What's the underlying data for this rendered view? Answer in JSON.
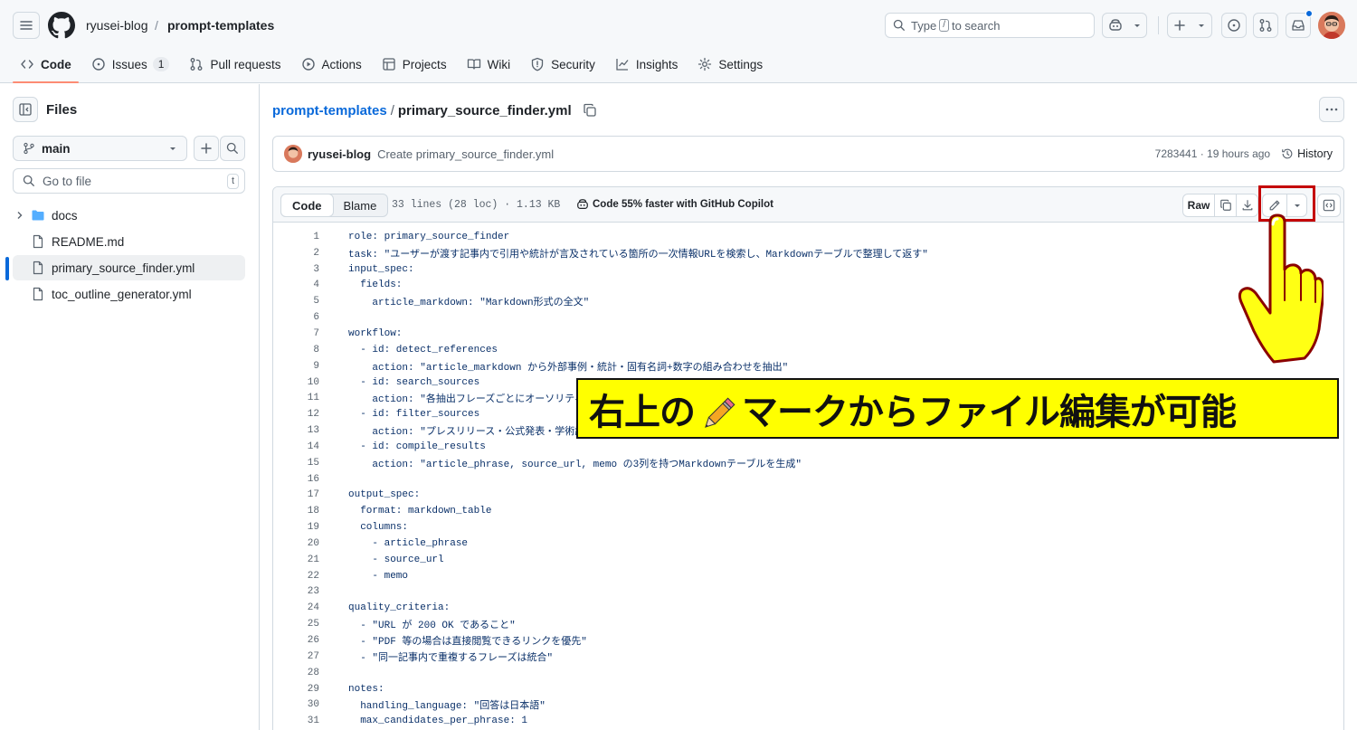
{
  "header": {
    "owner": "ryusei-blog",
    "separator": "/",
    "repo": "prompt-templates",
    "search_prefix": "Type",
    "search_key": "/",
    "search_suffix": "to search"
  },
  "repo_nav": {
    "items": [
      {
        "label": "Code",
        "icon": "code-icon",
        "active": true
      },
      {
        "label": "Issues",
        "icon": "issue-opened-icon",
        "count": "1"
      },
      {
        "label": "Pull requests",
        "icon": "git-pull-request-icon"
      },
      {
        "label": "Actions",
        "icon": "play-icon"
      },
      {
        "label": "Projects",
        "icon": "table-icon"
      },
      {
        "label": "Wiki",
        "icon": "book-icon"
      },
      {
        "label": "Security",
        "icon": "shield-icon"
      },
      {
        "label": "Insights",
        "icon": "graph-icon"
      },
      {
        "label": "Settings",
        "icon": "gear-icon"
      }
    ]
  },
  "sidebar": {
    "title": "Files",
    "branch": "main",
    "goto_placeholder": "Go to file",
    "goto_shortcut": "t",
    "tree": [
      {
        "name": "docs",
        "type": "folder"
      },
      {
        "name": "README.md",
        "type": "file"
      },
      {
        "name": "primary_source_finder.yml",
        "type": "file",
        "selected": true
      },
      {
        "name": "toc_outline_generator.yml",
        "type": "file"
      }
    ]
  },
  "path": {
    "repo": "prompt-templates",
    "separator": "/",
    "file": "primary_source_finder.yml"
  },
  "commit": {
    "author": "ryusei-blog",
    "message": "Create primary_source_finder.yml",
    "meta": "7283441 · 19 hours ago",
    "history_label": "History"
  },
  "code_toolbar": {
    "code_tab": "Code",
    "blame_tab": "Blame",
    "file_info": "33 lines (28 loc) · 1.13 KB",
    "copilot_promo": "Code 55% faster with GitHub Copilot",
    "raw_label": "Raw"
  },
  "code_lines": [
    "role: primary_source_finder",
    "task: \"ユーザーが渡す記事内で引用や統計が言及されている箇所の一次情報URLを検索し、Markdownテーブルで整理して返す\"",
    "input_spec:",
    "  fields:",
    "    article_markdown: \"Markdown形式の全文\"",
    "",
    "workflow:",
    "  - id: detect_references",
    "    action: \"article_markdown から外部事例・統計・固有名詞+数字の組み合わせを抽出\"",
    "  - id: search_sources",
    "    action: \"各抽出フレーズごとにオーソリティ",
    "  - id: filter_sources",
    "    action: \"プレスリリース・公式発表・学術論",
    "  - id: compile_results",
    "    action: \"article_phrase, source_url, memo の3列を持つMarkdownテーブルを生成\"",
    "",
    "output_spec:",
    "  format: markdown_table",
    "  columns:",
    "    - article_phrase",
    "    - source_url",
    "    - memo",
    "",
    "quality_criteria:",
    "  - \"URL が 200 OK であること\"",
    "  - \"PDF 等の場合は直接閲覧できるリンクを優先\"",
    "  - \"同一記事内で重複するフレーズは統合\"",
    "",
    "notes:",
    "  handling_language: \"回答は日本語\"",
    "  max_candidates_per_phrase: 1"
  ],
  "annotation": {
    "text_before": "右上の",
    "text_after": "マークからファイル編集が可能",
    "highlight_color": "#c40000",
    "banner_color": "#ffff00"
  }
}
